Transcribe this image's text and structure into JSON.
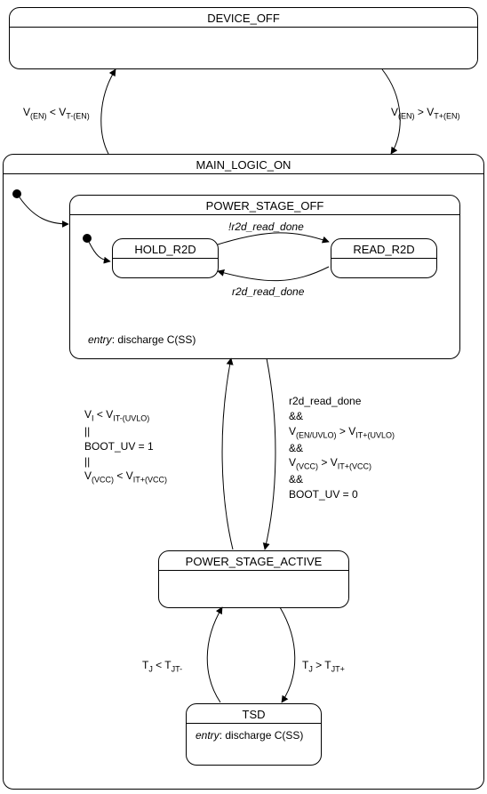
{
  "chart_data": {
    "type": "table",
    "kind": "uml-statechart",
    "states": [
      {
        "id": "device_off",
        "name": "DEVICE_OFF",
        "body": ""
      },
      {
        "id": "main_logic_on",
        "name": "MAIN_LOGIC_ON",
        "composite": true
      },
      {
        "id": "power_stage_off",
        "name": "POWER_STAGE_OFF",
        "parent": "main_logic_on",
        "composite": true,
        "entry": "discharge C(SS)"
      },
      {
        "id": "hold_r2d",
        "name": "HOLD_R2D",
        "parent": "power_stage_off"
      },
      {
        "id": "read_r2d",
        "name": "READ_R2D",
        "parent": "power_stage_off"
      },
      {
        "id": "power_stage_active",
        "name": "POWER_STAGE_ACTIVE",
        "parent": "main_logic_on"
      },
      {
        "id": "tsd",
        "name": "TSD",
        "parent": "main_logic_on",
        "entry": "discharge C(SS)"
      }
    ],
    "initial_states": [
      {
        "target": "power_stage_off",
        "in": "main_logic_on"
      },
      {
        "target": "hold_r2d",
        "in": "power_stage_off"
      }
    ],
    "transitions": [
      {
        "from": "device_off",
        "to": "main_logic_on",
        "guard": "V(EN) > VT+(EN)"
      },
      {
        "from": "main_logic_on",
        "to": "device_off",
        "guard": "V(EN) < VT-(EN)"
      },
      {
        "from": "hold_r2d",
        "to": "read_r2d",
        "guard": "!r2d_read_done"
      },
      {
        "from": "read_r2d",
        "to": "hold_r2d",
        "guard": "r2d_read_done"
      },
      {
        "from": "power_stage_off",
        "to": "power_stage_active",
        "guard": "r2d_read_done && V(EN/UVLO) > VIT+(UVLO) && V(VCC) > VIT+(VCC) && BOOT_UV = 0"
      },
      {
        "from": "power_stage_active",
        "to": "power_stage_off",
        "guard": "VI < VIT-(UVLO) || BOOT_UV = 1 || V(VCC) < VIT+(VCC)"
      },
      {
        "from": "power_stage_active",
        "to": "tsd",
        "guard": "TJ > TJT+"
      },
      {
        "from": "tsd",
        "to": "power_stage_active",
        "guard": "TJ < TJT-"
      }
    ]
  },
  "labels": {
    "device_off": "DEVICE_OFF",
    "main_logic_on": "MAIN_LOGIC_ON",
    "power_stage_off": "POWER_STAGE_OFF",
    "hold_r2d": "HOLD_R2D",
    "read_r2d": "READ_R2D",
    "power_stage_active": "POWER_STAGE_ACTIVE",
    "tsd": "TSD",
    "entry_word": "entry",
    "discharge_css": ": discharge C",
    "css_sub": "(SS)",
    "t_not_r2d": "!r2d_read_done",
    "t_r2d": "r2d_read_done",
    "amp": "&&",
    "or": "||",
    "cond_en_gt": "V",
    "en_sub": "(EN)",
    "gt": " > V",
    "lt": " < V",
    "tplus_en_sub": "T+(EN)",
    "tminus_en_sub": "T-(EN)",
    "Vi": "V",
    "I_sub": "I",
    "it_minus_uvlo_sub": "IT-(UVLO)",
    "boot1": "BOOT_UV = 1",
    "boot0": "BOOT_UV = 0",
    "vcc_sub": "(VCC)",
    "it_plus_vcc_sub": "IT+(VCC)",
    "r2d_done": "r2d_read_done",
    "en_uvlo_sub": "(EN/UVLO)",
    "it_plus_uvlo_sub": "IT+(UVLO)",
    "TJ": "T",
    "J_sub": "J",
    "TJTplus_sub": "JT+",
    "TJTminus_sub": "JT-"
  }
}
